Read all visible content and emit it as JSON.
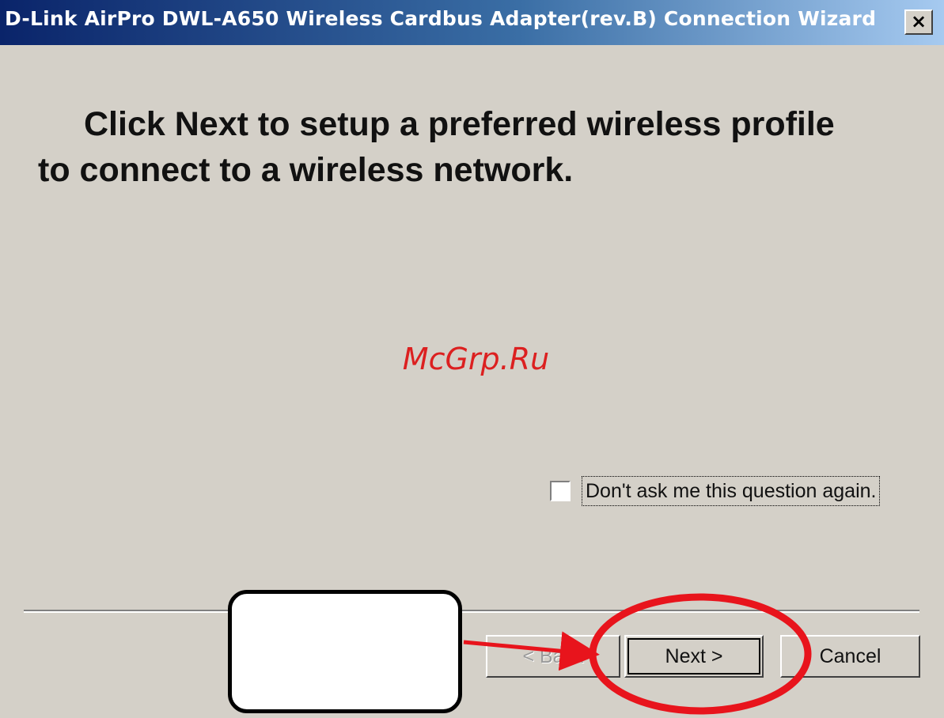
{
  "window": {
    "title": "D-Link AirPro DWL-A650 Wireless Cardbus Adapter(rev.B) Connection Wizard",
    "close_glyph": "×"
  },
  "main": {
    "headline_line1": "Click Next to setup a preferred wireless profile",
    "headline_line2": "to connect to a wireless network.",
    "watermark": "McGrp.Ru"
  },
  "options": {
    "dont_ask_label": "Don't ask me this question again.",
    "dont_ask_checked": false
  },
  "buttons": {
    "back_label": "< Back",
    "next_label": "Next >",
    "cancel_label": "Cancel"
  },
  "annotation": {
    "callout_text": "",
    "highlight_color": "#e8141c",
    "arrow_color": "#e8141c"
  },
  "colors": {
    "dialog_bg": "#d4d0c8",
    "title_gradient_start": "#0a246a",
    "title_gradient_end": "#a6caf0"
  }
}
